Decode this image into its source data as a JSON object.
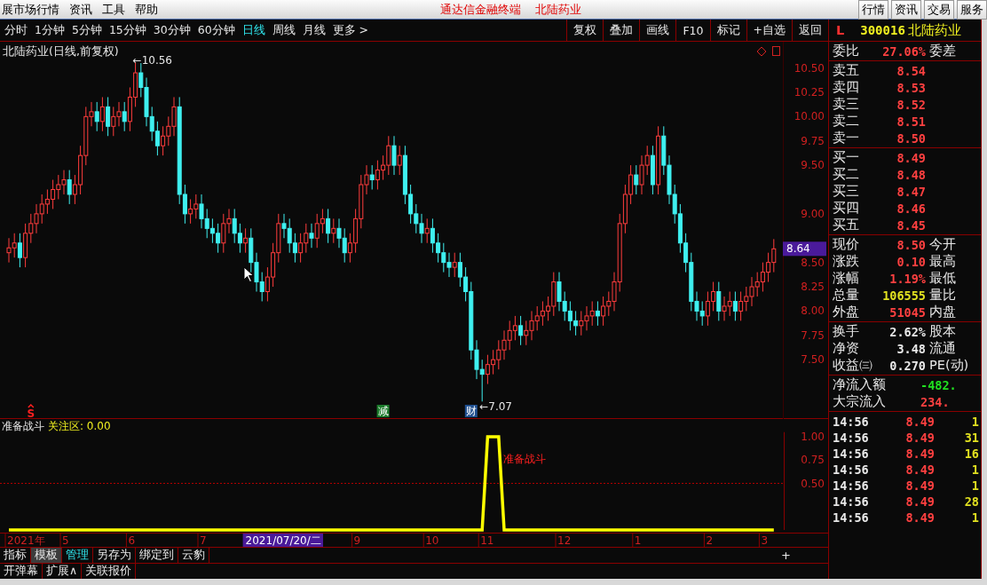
{
  "menu_bar": {
    "items": [
      "展市场行情",
      "资讯",
      "工具",
      "帮助"
    ],
    "title": "通达信金融终端",
    "stock": "北陆药业",
    "buttons": [
      "行情",
      "资讯",
      "交易",
      "服务"
    ]
  },
  "period_bar": {
    "periods": [
      {
        "label": "分时",
        "selected": false
      },
      {
        "label": "1分钟",
        "selected": false
      },
      {
        "label": "5分钟",
        "selected": false
      },
      {
        "label": "15分钟",
        "selected": false
      },
      {
        "label": "30分钟",
        "selected": false
      },
      {
        "label": "60分钟",
        "selected": false
      },
      {
        "label": "日线",
        "selected": true
      },
      {
        "label": "周线",
        "selected": false
      },
      {
        "label": "月线",
        "selected": false
      },
      {
        "label": "更多 >",
        "selected": false
      }
    ],
    "tools": [
      "复权",
      "叠加",
      "画线",
      "F10",
      "标记",
      "+自选",
      "返回"
    ]
  },
  "main_chart": {
    "title": "北陆药业(日线,前复权)",
    "price_tag": "8.64",
    "chart_data": {
      "type": "candlestick",
      "ylim": [
        6.89,
        10.77
      ],
      "yticks": [
        {
          "value": 10.5,
          "label": "10.50"
        },
        {
          "value": 10.25,
          "label": "10.25"
        },
        {
          "value": 10.0,
          "label": "10.00"
        },
        {
          "value": 9.75,
          "label": "9.75"
        },
        {
          "value": 9.5,
          "label": "9.50"
        },
        {
          "value": 9.0,
          "label": "9.00"
        },
        {
          "value": 8.5,
          "label": "8.50"
        },
        {
          "value": 8.25,
          "label": "8.25"
        },
        {
          "value": 8.0,
          "label": "8.00"
        },
        {
          "value": 7.75,
          "label": "7.75"
        },
        {
          "value": 7.5,
          "label": "7.50"
        }
      ],
      "categories": [
        null,
        null,
        null,
        null,
        null,
        null,
        null,
        null,
        null,
        null,
        null,
        null,
        null,
        null,
        null,
        null,
        null,
        null,
        null,
        null,
        null,
        null,
        null,
        null,
        null,
        null,
        null,
        null,
        null,
        null,
        null,
        null,
        null,
        null,
        null,
        null,
        null,
        null,
        null,
        null,
        null,
        null,
        null,
        null,
        null,
        null,
        null,
        null,
        null,
        null,
        null,
        null,
        null,
        null,
        null,
        null,
        null,
        null,
        null,
        null,
        null,
        null,
        null,
        null,
        null,
        null,
        null,
        null,
        null,
        null,
        null,
        null,
        null,
        null,
        null,
        null,
        null,
        null,
        null,
        null,
        null,
        null,
        null,
        null,
        null,
        null,
        null,
        null,
        null,
        null,
        null,
        null,
        null,
        null,
        null,
        null,
        null,
        null,
        null,
        null,
        null,
        null,
        null,
        null,
        null,
        null,
        null,
        null,
        null,
        null,
        null,
        null,
        null,
        null,
        null,
        null,
        null,
        null,
        null,
        null,
        null,
        null,
        null,
        null,
        null,
        null,
        null,
        null,
        null,
        null,
        null,
        null,
        null,
        null,
        null,
        null,
        null,
        null,
        null,
        null
      ],
      "ohlc": [
        [
          8.6,
          8.75,
          8.5,
          8.65
        ],
        [
          8.65,
          8.8,
          8.55,
          8.7
        ],
        [
          8.7,
          8.8,
          8.45,
          8.55
        ],
        [
          8.55,
          8.9,
          8.45,
          8.8
        ],
        [
          8.8,
          9.0,
          8.7,
          8.9
        ],
        [
          8.9,
          9.1,
          8.8,
          9.0
        ],
        [
          9.0,
          9.2,
          8.9,
          9.1
        ],
        [
          9.1,
          9.25,
          9.0,
          9.15
        ],
        [
          9.15,
          9.35,
          9.05,
          9.25
        ],
        [
          9.25,
          9.4,
          9.15,
          9.3
        ],
        [
          9.3,
          9.45,
          9.2,
          9.35
        ],
        [
          9.35,
          9.45,
          9.1,
          9.2
        ],
        [
          9.2,
          9.4,
          9.1,
          9.3
        ],
        [
          9.3,
          9.7,
          9.2,
          9.6
        ],
        [
          9.6,
          10.1,
          9.5,
          10.0
        ],
        [
          10.0,
          10.15,
          9.9,
          10.05
        ],
        [
          10.05,
          10.15,
          9.85,
          9.95
        ],
        [
          9.95,
          10.2,
          9.85,
          10.1
        ],
        [
          10.1,
          10.2,
          9.8,
          9.9
        ],
        [
          9.9,
          10.1,
          9.8,
          10.0
        ],
        [
          10.0,
          10.15,
          9.9,
          10.05
        ],
        [
          10.05,
          10.15,
          9.85,
          9.95
        ],
        [
          9.95,
          10.3,
          9.85,
          10.2
        ],
        [
          10.2,
          10.56,
          10.1,
          10.45
        ],
        [
          10.45,
          10.55,
          10.2,
          10.3
        ],
        [
          10.3,
          10.4,
          9.9,
          10.0
        ],
        [
          10.0,
          10.1,
          9.75,
          9.85
        ],
        [
          9.85,
          9.95,
          9.6,
          9.7
        ],
        [
          9.7,
          9.9,
          9.6,
          9.8
        ],
        [
          9.8,
          10.0,
          9.7,
          9.9
        ],
        [
          9.9,
          10.2,
          9.8,
          10.1
        ],
        [
          10.1,
          10.2,
          9.1,
          9.2
        ],
        [
          9.2,
          9.3,
          8.9,
          9.0
        ],
        [
          9.0,
          9.15,
          8.9,
          9.05
        ],
        [
          9.05,
          9.2,
          8.95,
          9.1
        ],
        [
          9.1,
          9.2,
          8.85,
          8.95
        ],
        [
          8.95,
          9.05,
          8.75,
          8.85
        ],
        [
          8.85,
          8.95,
          8.7,
          8.8
        ],
        [
          8.8,
          8.9,
          8.6,
          8.7
        ],
        [
          8.7,
          9.0,
          8.6,
          8.9
        ],
        [
          8.9,
          9.05,
          8.8,
          8.95
        ],
        [
          8.95,
          9.05,
          8.7,
          8.8
        ],
        [
          8.8,
          8.9,
          8.6,
          8.7
        ],
        [
          8.7,
          8.85,
          8.6,
          8.75
        ],
        [
          8.75,
          8.85,
          8.4,
          8.5
        ],
        [
          8.5,
          8.6,
          8.2,
          8.3
        ],
        [
          8.3,
          8.4,
          8.1,
          8.2
        ],
        [
          8.2,
          8.45,
          8.1,
          8.35
        ],
        [
          8.35,
          8.7,
          8.25,
          8.6
        ],
        [
          8.6,
          9.0,
          8.5,
          8.9
        ],
        [
          8.9,
          9.0,
          8.75,
          8.85
        ],
        [
          8.85,
          8.95,
          8.6,
          8.7
        ],
        [
          8.7,
          8.8,
          8.5,
          8.6
        ],
        [
          8.6,
          8.8,
          8.5,
          8.7
        ],
        [
          8.7,
          8.9,
          8.6,
          8.8
        ],
        [
          8.8,
          8.9,
          8.65,
          8.75
        ],
        [
          8.75,
          9.0,
          8.65,
          8.9
        ],
        [
          8.9,
          9.05,
          8.8,
          8.95
        ],
        [
          8.95,
          9.05,
          8.7,
          8.8
        ],
        [
          8.8,
          8.95,
          8.7,
          8.85
        ],
        [
          8.85,
          8.95,
          8.65,
          8.75
        ],
        [
          8.75,
          8.85,
          8.5,
          8.6
        ],
        [
          8.6,
          8.8,
          8.5,
          8.7
        ],
        [
          8.7,
          9.05,
          8.6,
          8.95
        ],
        [
          8.95,
          9.4,
          8.85,
          9.3
        ],
        [
          9.3,
          9.5,
          9.2,
          9.4
        ],
        [
          9.4,
          9.5,
          9.25,
          9.35
        ],
        [
          9.35,
          9.55,
          9.25,
          9.45
        ],
        [
          9.45,
          9.6,
          9.35,
          9.5
        ],
        [
          9.5,
          9.8,
          9.4,
          9.7
        ],
        [
          9.7,
          9.8,
          9.4,
          9.5
        ],
        [
          9.5,
          9.7,
          9.4,
          9.6
        ],
        [
          9.6,
          9.7,
          9.1,
          9.2
        ],
        [
          9.2,
          9.3,
          8.9,
          9.0
        ],
        [
          9.0,
          9.1,
          8.8,
          8.9
        ],
        [
          8.9,
          9.0,
          8.7,
          8.8
        ],
        [
          8.8,
          8.95,
          8.7,
          8.85
        ],
        [
          8.85,
          8.95,
          8.6,
          8.7
        ],
        [
          8.7,
          8.8,
          8.5,
          8.6
        ],
        [
          8.6,
          8.7,
          8.4,
          8.5
        ],
        [
          8.5,
          8.6,
          8.35,
          8.45
        ],
        [
          8.45,
          8.6,
          8.35,
          8.5
        ],
        [
          8.5,
          8.6,
          8.25,
          8.35
        ],
        [
          8.35,
          8.45,
          8.1,
          8.2
        ],
        [
          8.2,
          8.3,
          7.5,
          7.6
        ],
        [
          7.6,
          7.7,
          7.3,
          7.4
        ],
        [
          7.4,
          7.5,
          7.07,
          7.35
        ],
        [
          7.35,
          7.55,
          7.25,
          7.45
        ],
        [
          7.45,
          7.6,
          7.35,
          7.5
        ],
        [
          7.5,
          7.7,
          7.4,
          7.6
        ],
        [
          7.6,
          7.8,
          7.5,
          7.7
        ],
        [
          7.7,
          7.9,
          7.6,
          7.8
        ],
        [
          7.8,
          7.95,
          7.7,
          7.85
        ],
        [
          7.85,
          7.95,
          7.65,
          7.75
        ],
        [
          7.75,
          7.9,
          7.65,
          7.8
        ],
        [
          7.8,
          8.0,
          7.7,
          7.9
        ],
        [
          7.9,
          8.05,
          7.8,
          7.95
        ],
        [
          7.95,
          8.1,
          7.85,
          8.0
        ],
        [
          8.0,
          8.15,
          7.9,
          8.05
        ],
        [
          8.05,
          8.4,
          7.95,
          8.3
        ],
        [
          8.3,
          8.4,
          8.0,
          8.1
        ],
        [
          8.1,
          8.2,
          7.9,
          8.0
        ],
        [
          8.0,
          8.1,
          7.8,
          7.9
        ],
        [
          7.9,
          8.0,
          7.75,
          7.85
        ],
        [
          7.85,
          8.0,
          7.75,
          7.9
        ],
        [
          7.9,
          8.05,
          7.8,
          7.95
        ],
        [
          7.95,
          8.1,
          7.85,
          8.0
        ],
        [
          8.0,
          8.1,
          7.85,
          7.95
        ],
        [
          7.95,
          8.15,
          7.85,
          8.05
        ],
        [
          8.05,
          8.2,
          7.95,
          8.1
        ],
        [
          8.1,
          8.4,
          8.0,
          8.3
        ],
        [
          8.3,
          9.0,
          8.2,
          8.9
        ],
        [
          8.9,
          9.3,
          8.8,
          9.2
        ],
        [
          9.2,
          9.5,
          9.1,
          9.4
        ],
        [
          9.4,
          9.5,
          9.2,
          9.3
        ],
        [
          9.3,
          9.6,
          9.2,
          9.5
        ],
        [
          9.5,
          9.7,
          9.4,
          9.6
        ],
        [
          9.6,
          9.7,
          9.2,
          9.3
        ],
        [
          9.3,
          9.9,
          9.2,
          9.8
        ],
        [
          9.8,
          9.9,
          9.4,
          9.5
        ],
        [
          9.5,
          9.6,
          9.1,
          9.2
        ],
        [
          9.2,
          9.3,
          8.9,
          9.0
        ],
        [
          9.0,
          9.1,
          8.6,
          8.7
        ],
        [
          8.7,
          8.8,
          8.4,
          8.5
        ],
        [
          8.5,
          8.6,
          8.0,
          8.1
        ],
        [
          8.1,
          8.2,
          7.9,
          8.0
        ],
        [
          8.0,
          8.1,
          7.85,
          7.95
        ],
        [
          7.95,
          8.2,
          7.85,
          8.1
        ],
        [
          8.1,
          8.3,
          8.0,
          8.2
        ],
        [
          8.2,
          8.3,
          7.9,
          8.0
        ],
        [
          8.0,
          8.15,
          7.9,
          8.05
        ],
        [
          8.05,
          8.2,
          7.95,
          8.1
        ],
        [
          8.1,
          8.2,
          7.9,
          8.0
        ],
        [
          8.0,
          8.2,
          7.9,
          8.1
        ],
        [
          8.1,
          8.25,
          8.0,
          8.15
        ],
        [
          8.15,
          8.35,
          8.05,
          8.25
        ],
        [
          8.25,
          8.4,
          8.15,
          8.3
        ],
        [
          8.3,
          8.5,
          8.2,
          8.4
        ],
        [
          8.4,
          8.6,
          8.3,
          8.5
        ],
        [
          8.5,
          8.74,
          8.4,
          8.64
        ]
      ],
      "annotations": [
        "←10.56",
        "←7.07"
      ]
    },
    "markers": [
      {
        "text": "S",
        "kind": "signal",
        "color": "#ff2020"
      },
      {
        "text": "减",
        "kind": "badge",
        "color": "#1a7a2a"
      },
      {
        "text": "财",
        "kind": "badge",
        "color": "#1f4f8f"
      }
    ]
  },
  "indicator": {
    "reading": "关注区: 0.00",
    "signal_label": "准备战斗",
    "chart_data": {
      "type": "line",
      "ylim": [
        0,
        1.05
      ],
      "yticks": [
        {
          "value": 1,
          "label": "1.00"
        },
        {
          "value": 0.75,
          "label": "0.75"
        },
        {
          "value": 0.5,
          "label": "0.50"
        }
      ],
      "ref_lines": [
        {
          "axis": "y",
          "value": 0.5
        }
      ],
      "series": [
        {
          "name": "准备战斗",
          "color": "#ffff00",
          "values": [
            0,
            0,
            0,
            0,
            0,
            0,
            0,
            0,
            0,
            0,
            0,
            0,
            0,
            0,
            0,
            0,
            0,
            0,
            0,
            0,
            0,
            0,
            0,
            0,
            0,
            0,
            0,
            0,
            0,
            0,
            0,
            0,
            0,
            0,
            0,
            0,
            0,
            0,
            0,
            0,
            0,
            0,
            0,
            0,
            0,
            0,
            0,
            0,
            0,
            0,
            0,
            0,
            0,
            0,
            0,
            0,
            0,
            0,
            0,
            0,
            0,
            0,
            0,
            0,
            0,
            0,
            0,
            0,
            0,
            0,
            0,
            0,
            0,
            0,
            0,
            0,
            0,
            0,
            0,
            0,
            0,
            0,
            0,
            0,
            0,
            0,
            0,
            1,
            1,
            1,
            0,
            0,
            0,
            0,
            0,
            0,
            0,
            0,
            0,
            0,
            0,
            0,
            0,
            0,
            0,
            0,
            0,
            0,
            0,
            0,
            0,
            0,
            0,
            0,
            0,
            0,
            0,
            0,
            0,
            0,
            0,
            0,
            0,
            0,
            0,
            0,
            0,
            0,
            0,
            0,
            0,
            0,
            0,
            0,
            0,
            0,
            0,
            0,
            0,
            0
          ]
        }
      ]
    }
  },
  "date_axis": {
    "ticks": [
      "2021年",
      "5",
      "6",
      "7",
      "9",
      "10",
      "11",
      "12",
      "1",
      "2",
      "3"
    ],
    "cursor": "2021/07/20/二"
  },
  "bottom_tabs": {
    "rows": [
      {
        "tabs": [
          {
            "label": "指标",
            "selected": false,
            "active": false
          },
          {
            "label": "模板",
            "selected": true,
            "active": false
          },
          {
            "label": "管理",
            "selected": false,
            "active": true
          },
          {
            "label": "另存为",
            "selected": false,
            "active": false
          },
          {
            "label": "绑定到",
            "selected": false,
            "active": false
          },
          {
            "label": "云豹",
            "selected": false,
            "active": false
          }
        ]
      },
      {
        "tabs": [
          {
            "label": "开弹幕",
            "selected": false,
            "active": false
          },
          {
            "label": "扩展∧",
            "selected": false,
            "active": false
          },
          {
            "label": "关联报价",
            "selected": false,
            "active": false
          }
        ]
      }
    ],
    "plus": "+"
  },
  "quote_panel": {
    "market": "L",
    "code": "300016",
    "name": "北陆药业",
    "ratio": {
      "label": "委比",
      "value": "27.06%",
      "label2": "委差"
    },
    "asks": [
      {
        "label": "卖五",
        "price": "8.54"
      },
      {
        "label": "卖四",
        "price": "8.53"
      },
      {
        "label": "卖三",
        "price": "8.52"
      },
      {
        "label": "卖二",
        "price": "8.51"
      },
      {
        "label": "卖一",
        "price": "8.50"
      }
    ],
    "bids": [
      {
        "label": "买一",
        "price": "8.49"
      },
      {
        "label": "买二",
        "price": "8.48"
      },
      {
        "label": "买三",
        "price": "8.47"
      },
      {
        "label": "买四",
        "price": "8.46"
      },
      {
        "label": "买五",
        "price": "8.45"
      }
    ],
    "stats": [
      {
        "label": "现价",
        "value": "8.50",
        "label2": "今开",
        "color": "#ff4040"
      },
      {
        "label": "涨跌",
        "value": "0.10",
        "label2": "最高",
        "color": "#ff4040"
      },
      {
        "label": "涨幅",
        "value": "1.19%",
        "label2": "最低",
        "color": "#ff4040"
      },
      {
        "label": "总量",
        "value": "106555",
        "label2": "量比",
        "color": "#e0e020"
      },
      {
        "label": "外盘",
        "value": "51045",
        "label2": "内盘",
        "color": "#ff4040"
      }
    ],
    "fundamentals": [
      {
        "label": "换手",
        "value": "2.62%",
        "label2": "股本"
      },
      {
        "label": "净资",
        "value": "3.48",
        "label2": "流通"
      },
      {
        "label": "收益㈢",
        "value": "0.270",
        "label2": "PE(动)"
      }
    ],
    "flows": [
      {
        "label": "净流入额",
        "value": "-482.",
        "color": "#20e020"
      },
      {
        "label": "大宗流入",
        "value": "234.",
        "color": "#ff4040"
      }
    ],
    "ticks": [
      {
        "time": "14:56",
        "price": "8.49",
        "volume": "1"
      },
      {
        "time": "14:56",
        "price": "8.49",
        "volume": "31"
      },
      {
        "time": "14:56",
        "price": "8.49",
        "volume": "16"
      },
      {
        "time": "14:56",
        "price": "8.49",
        "volume": "1"
      },
      {
        "time": "14:56",
        "price": "8.49",
        "volume": "1"
      },
      {
        "time": "14:56",
        "price": "8.49",
        "volume": "28"
      },
      {
        "time": "14:56",
        "price": "8.49",
        "volume": "1"
      }
    ]
  }
}
